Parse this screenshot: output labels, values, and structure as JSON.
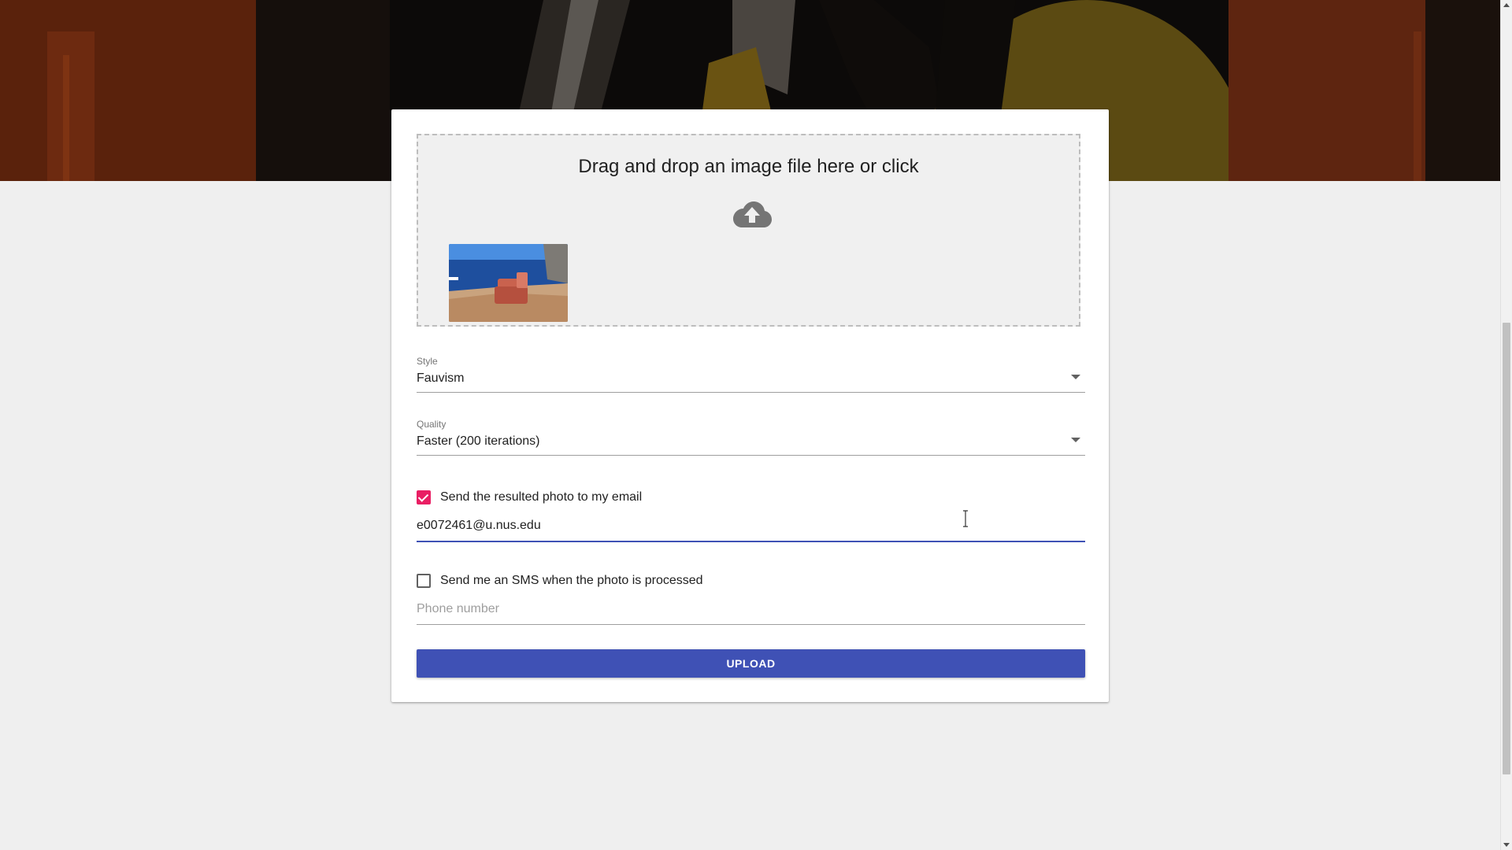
{
  "dropzone": {
    "title": "Drag and drop an image file here or click",
    "upload_icon": "cloud-upload-icon",
    "thumbnail_alt": "uploaded image thumbnail"
  },
  "style_select": {
    "label": "Style",
    "value": "Fauvism"
  },
  "quality_select": {
    "label": "Quality",
    "value": "Faster (200 iterations)"
  },
  "email_option": {
    "checked": true,
    "label": "Send the resulted photo to my email",
    "value": "e0072461@u.nus.edu"
  },
  "sms_option": {
    "checked": false,
    "label": "Send me an SMS when the photo is processed",
    "placeholder": "Phone number"
  },
  "upload_button": {
    "label": "UPLOAD"
  },
  "colors": {
    "primary": "#3f51b5",
    "checkbox_accent": "#e91e63",
    "page_background": "#efefef"
  }
}
